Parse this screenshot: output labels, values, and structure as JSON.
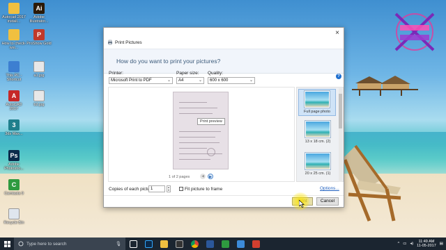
{
  "desktop": {
    "icons": [
      {
        "label": "Autocad 2017 install...",
        "color": "#f0c040",
        "glyph": "folder-icon"
      },
      {
        "label": "Adobe Illustrator...",
        "color": "#2b1a08",
        "glyph": "Ai"
      },
      {
        "label": "How to check-wsi...",
        "color": "#f0c040",
        "glyph": "folder-icon"
      },
      {
        "label": "ProShow Gold",
        "color": "#c0392b",
        "glyph": "P"
      },
      {
        "label": "This PC - Shortcut",
        "color": "#3d7fd1",
        "glyph": "pc-icon"
      },
      {
        "label": "a1.jpg",
        "color": "#e8e8e8",
        "glyph": "file-icon"
      },
      {
        "label": "AutoCAD 2017",
        "color": "#c62828",
        "glyph": "A"
      },
      {
        "label": "b2.jpg",
        "color": "#e8e8e8",
        "glyph": "file-icon"
      },
      {
        "label": "3ds Max...",
        "color": "#1f7f8c",
        "glyph": "3"
      },
      {
        "label": "Adobe Photosho...",
        "color": "#0b2a4a",
        "glyph": "Ps"
      },
      {
        "label": "Camtasia 9",
        "color": "#2e9a3f",
        "glyph": "C"
      },
      {
        "label": "Recycle Bin",
        "color": "#dfe6ee",
        "glyph": "recycle-bin-icon"
      }
    ]
  },
  "dialog": {
    "title": "Print Pictures",
    "close": "×",
    "question": "How do you want to print your pictures?",
    "printer_label": "Printer:",
    "printer_value": "Microsoft Print to PDF",
    "paper_label": "Paper size:",
    "paper_value": "A4",
    "quality_label": "Quality:",
    "quality_value": "600 x 600",
    "help": "?",
    "tooltip": "Print preview",
    "page_count": "1 of 2 pages",
    "layouts": [
      {
        "label": "Full page photo",
        "selected": true
      },
      {
        "label": "13 x 18 cm. (2)",
        "selected": false
      },
      {
        "label": "20 x 25 cm. (1)",
        "selected": false
      }
    ],
    "copies_label": "Copies of each picture:",
    "copies_value": "1",
    "fit_label": "Fit picture to frame",
    "options_link": "Options...",
    "print_button": "Print",
    "cancel_button": "Cancel"
  },
  "taskbar": {
    "search_placeholder": "Type here to search",
    "time": "11:49 AM",
    "date": "11-05-2017"
  }
}
